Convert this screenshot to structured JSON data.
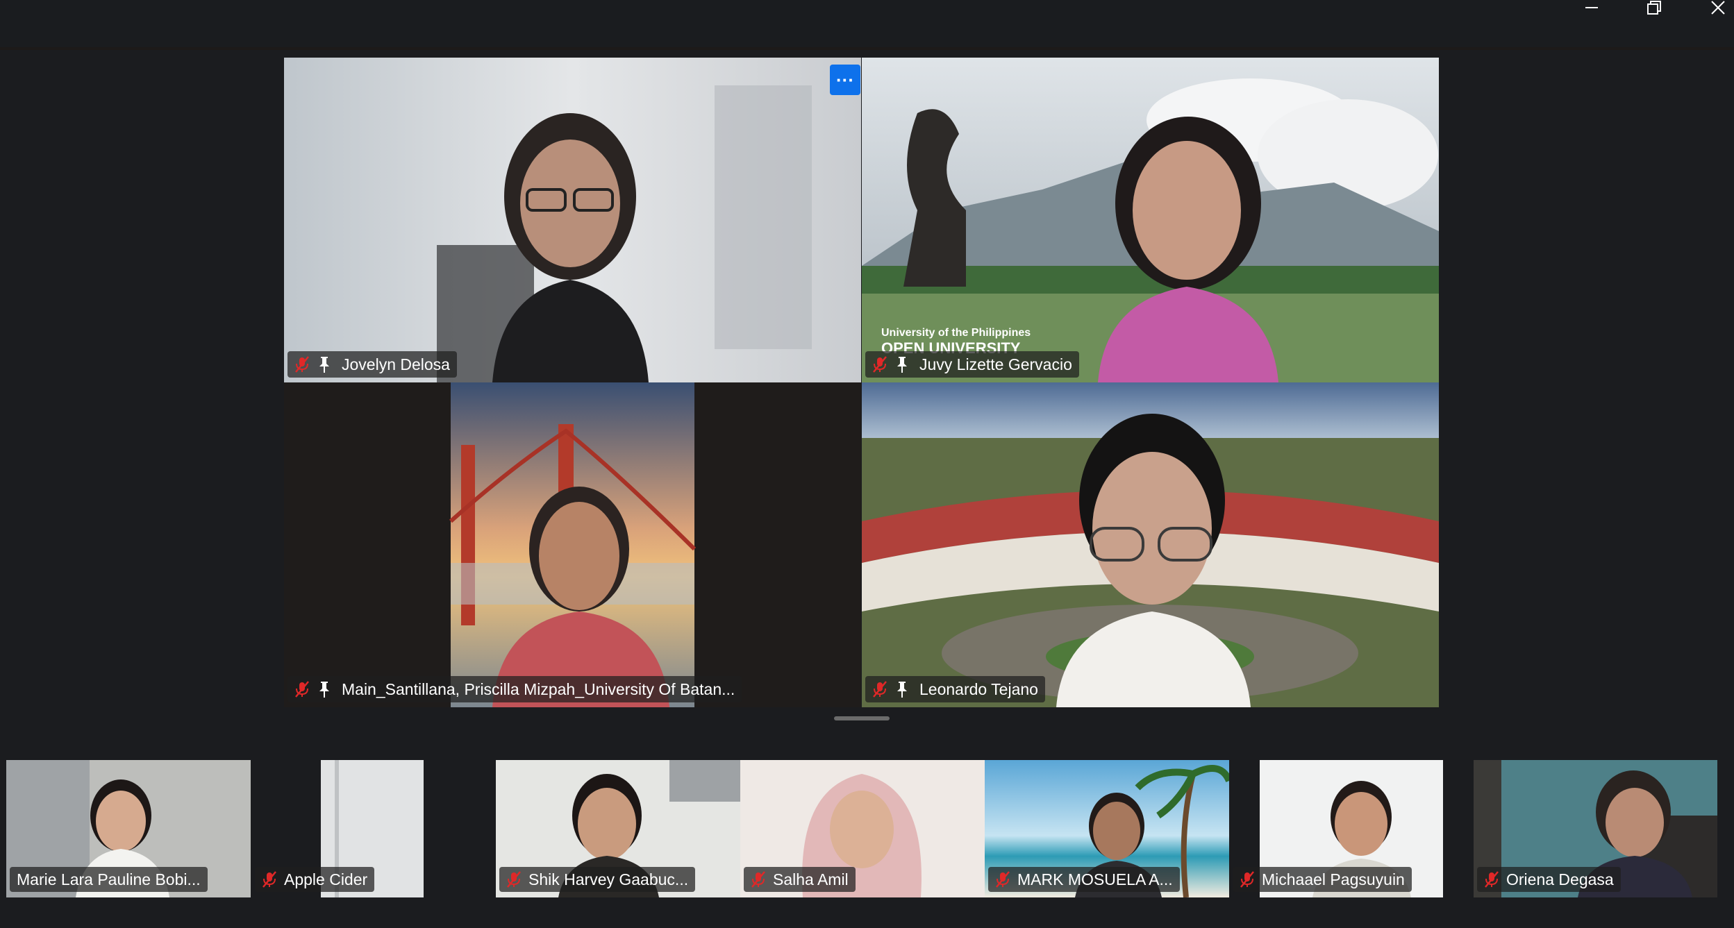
{
  "window": {
    "controls": [
      "minimize-icon",
      "restore-icon",
      "close-icon"
    ]
  },
  "main_grid": {
    "more_options_label": "···",
    "tiles": [
      {
        "name": "Jovelyn Delosa",
        "muted": true,
        "pinned": true
      },
      {
        "name": "Juvy Lizette Gervacio",
        "muted": true,
        "pinned": true,
        "background_text_1": "University of the Philippines",
        "background_text_2": "OPEN UNIVERSITY"
      },
      {
        "name": "Main_Santillana, Priscilla Mizpah_University Of Batan...",
        "muted": true,
        "pinned": true
      },
      {
        "name": "Leonardo Tejano",
        "muted": true,
        "pinned": true
      }
    ]
  },
  "gallery_strip": {
    "tiles": [
      {
        "name": "Marie Lara Pauline Bobi...",
        "muted": false
      },
      {
        "name": "Apple Cider",
        "muted": true
      },
      {
        "name": "Shik Harvey Gaabuc...",
        "muted": true
      },
      {
        "name": "Salha Amil",
        "muted": true
      },
      {
        "name": "MARK MOSUELA A...",
        "muted": true
      },
      {
        "name": "Michaael Pagsuyuin",
        "muted": true
      },
      {
        "name": "Oriena Degasa",
        "muted": true
      }
    ]
  },
  "colors": {
    "accent": "#0e71eb",
    "mute_red": "#e02828",
    "background": "#1b1c1f"
  }
}
